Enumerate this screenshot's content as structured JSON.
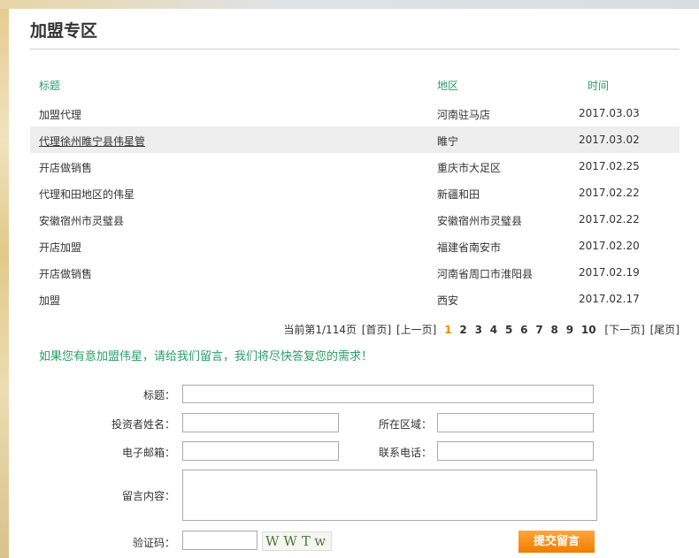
{
  "page": {
    "title": "加盟专区"
  },
  "table": {
    "headers": {
      "title": "标题",
      "region": "地区",
      "time": "时间"
    },
    "rows": [
      {
        "title": "加盟代理",
        "region": "河南驻马店",
        "time": "2017.03.03"
      },
      {
        "title": "代理徐州睢宁县伟星管",
        "region": "睢宁",
        "time": "2017.03.02"
      },
      {
        "title": "开店做销售",
        "region": "重庆市大足区",
        "time": "2017.02.25"
      },
      {
        "title": "代理和田地区的伟星",
        "region": "新疆和田",
        "time": "2017.02.22"
      },
      {
        "title": "安徽宿州市灵璧县",
        "region": "安徽宿州市灵璧县",
        "time": "2017.02.22"
      },
      {
        "title": "开店加盟",
        "region": "福建省南安市",
        "time": "2017.02.20"
      },
      {
        "title": "开店做销售",
        "region": "河南省周口市淮阳县",
        "time": "2017.02.19"
      },
      {
        "title": "加盟",
        "region": "西安",
        "time": "2017.02.17"
      }
    ]
  },
  "pager": {
    "status": "当前第1/114页",
    "first": "[首页]",
    "prev": "[上一页]",
    "pages": [
      "1",
      "2",
      "3",
      "4",
      "5",
      "6",
      "7",
      "8",
      "9",
      "10"
    ],
    "current": "1",
    "next": "[下一页]",
    "last": "[尾页]"
  },
  "form": {
    "notice": "如果您有意加盟伟星，请给我们留言，我们将尽快答复您的需求！",
    "title_label": "标题：",
    "investor_label": "投资者姓名：",
    "area_label": "所在区域：",
    "email_label": "电子邮箱：",
    "phone_label": "联系电话：",
    "content_label": "留言内容：",
    "captcha_label": "验证码：",
    "captcha_text": "WWTw",
    "submit_label": "提交留言"
  },
  "colors": {
    "accent": "#2a9b6a",
    "pager_current": "#f08a00",
    "submit": "#f07c00"
  }
}
